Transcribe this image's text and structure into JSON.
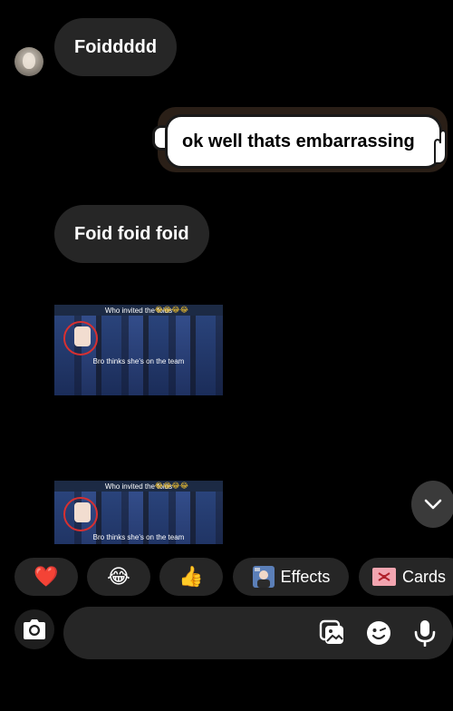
{
  "messages": {
    "incoming_1": "Foiddddd",
    "outgoing_1": "ok well thats embarrassing",
    "incoming_2": "Foid foid foid"
  },
  "memes": [
    {
      "top_caption": "Who invited the foids",
      "emojis": "😂😂😂😂",
      "bottom_caption": "Bro thinks she's on the team"
    },
    {
      "top_caption": "Who invited the foids",
      "emojis": "😂😂😂😂",
      "bottom_caption": "Bro thinks she's on the team"
    }
  ],
  "quick_reactions": [
    {
      "emoji": "❤️",
      "name": "heart"
    },
    {
      "emoji": "😂",
      "name": "laughing"
    },
    {
      "emoji": "👍",
      "name": "thumbs-up"
    }
  ],
  "actions": {
    "effects_label": "Effects",
    "cards_label": "Cards"
  },
  "composer": {
    "placeholder": ""
  },
  "icons": {
    "scroll_down": "chevron-down-icon",
    "camera": "camera-icon",
    "gallery": "gallery-icon",
    "sticker": "sticker-icon",
    "mic": "microphone-icon"
  },
  "colors": {
    "background": "#000000",
    "incoming_bubble": "#262626",
    "chip": "#262626",
    "scroll_button": "#3a3a3a"
  }
}
